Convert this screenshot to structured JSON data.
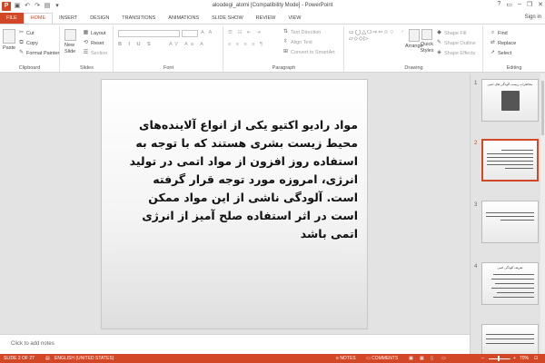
{
  "window": {
    "title": "aloodegi_atomi [Compatibility Mode] - PowerPoint",
    "app_logo": "P",
    "controls": [
      "?",
      "▭",
      "–",
      "❐",
      "✕"
    ]
  },
  "tabs": [
    "FILE",
    "HOME",
    "INSERT",
    "DESIGN",
    "TRANSITIONS",
    "ANIMATIONS",
    "SLIDE SHOW",
    "REVIEW",
    "VIEW"
  ],
  "active_tab": "HOME",
  "signin_label": "Sign in",
  "ribbon": {
    "clipboard": {
      "label": "Clipboard",
      "paste": "Paste",
      "cut": "Cut",
      "copy": "Copy",
      "format_painter": "Format Painter"
    },
    "slides": {
      "label": "Slides",
      "new_slide": "New Slide",
      "layout": "Layout",
      "reset": "Reset",
      "section": "Section"
    },
    "font": {
      "label": "Font"
    },
    "paragraph": {
      "label": "Paragraph",
      "text_direction": "Text Direction",
      "align_text": "Align Text",
      "convert_smartart": "Convert to SmartArt"
    },
    "drawing": {
      "label": "Drawing",
      "arrange": "Arrange",
      "quick_styles": "Quick Styles",
      "shape_fill": "Shape Fill",
      "shape_outline": "Shape Outline",
      "shape_effects": "Shape Effects"
    },
    "editing": {
      "label": "Editing",
      "find": "Find",
      "replace": "Replace",
      "select": "Select"
    }
  },
  "slide": {
    "body_text": "مواد رادیو اکتیو یکی از انواع آلاینده‌های محیط زیست بشری هستند که با توجه به استفاده روز افزون از مواد اتمی در تولید انرژی، امروزه مورد توجه قرار گرفته است. آلودگی ناشی از این مواد ممکن است در اثر استفاده صلح آمیز از انرژی اتمی باشد"
  },
  "notes_placeholder": "Click to add notes",
  "thumbnails": [
    {
      "num": "1",
      "title": "مخاطرات زیست آلودگی های اتمی"
    },
    {
      "num": "2",
      "title": ""
    },
    {
      "num": "3",
      "title": ""
    },
    {
      "num": "4",
      "title": "تعریف آلودگی اتمی"
    }
  ],
  "selected_slide_index": 2,
  "status": {
    "slide_indicator": "SLIDE 2 OF 27",
    "language": "ENGLISH (UNITED STATES)",
    "notes": "NOTES",
    "comments": "COMMENTS",
    "zoom": "70%"
  },
  "colors": {
    "accent": "#D24726"
  }
}
